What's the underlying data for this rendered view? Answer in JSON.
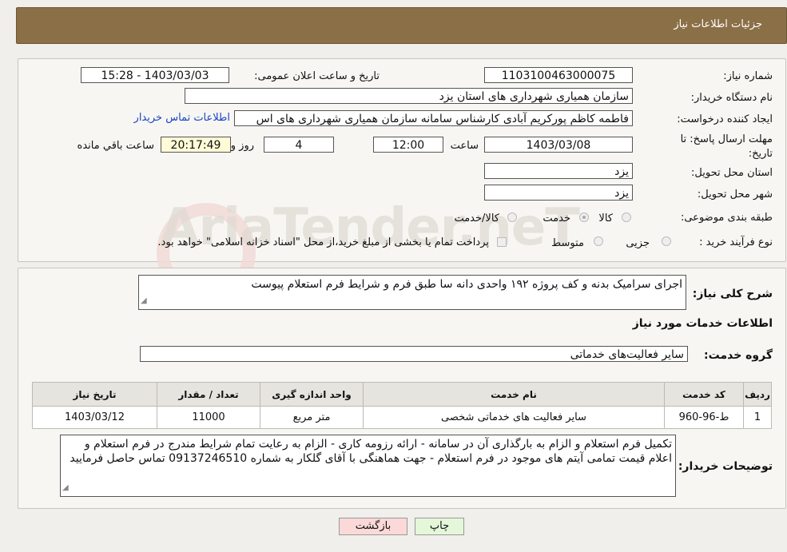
{
  "header": {
    "title": "جزئیات اطلاعات نیاز"
  },
  "info": {
    "need_number_label": "شماره نیاز:",
    "need_number": "1103100463000075",
    "announce_label": "تاریخ و ساعت اعلان عمومی:",
    "announce_value": "1403/03/03 - 15:28",
    "buyer_org_label": "نام دستگاه خریدار:",
    "buyer_org": "سازمان همیاری شهرداری های استان یزد",
    "requester_label": "ایجاد کننده درخواست:",
    "requester": "فاطمه کاظم پورکریم آبادی کارشناس سامانه سازمان همیاری شهرداری های اس",
    "contact_link": "اطلاعات تماس خریدار",
    "deadline_label": "مهلت ارسال پاسخ: تا تاریخ:",
    "deadline_date": "1403/03/08",
    "time_label": "ساعت",
    "deadline_time": "12:00",
    "days_value": "4",
    "days_label": "روز و",
    "remaining_time": "20:17:49",
    "remaining_label": "ساعت باقي مانده",
    "province_label": "استان محل تحویل:",
    "province": "یزد",
    "city_label": "شهر محل تحویل:",
    "city": "یزد",
    "category_label": "طبقه بندی موضوعی:",
    "category_options": [
      "کالا",
      "خدمت",
      "کالا/خدمت"
    ],
    "category_selected": "خدمت",
    "purchase_type_label": "نوع فرآیند خرید :",
    "purchase_options": [
      "جزیی",
      "متوسط"
    ],
    "payment_note": "پرداخت تمام یا بخشی از مبلغ خرید،از محل \"اسناد خزانه اسلامی\" خواهد بود."
  },
  "description": {
    "label": "شرح کلی نیاز:",
    "text": "اجرای سرامیک بدنه و کف پروژه ۱۹۲ واحدی دانه سا طبق فرم و شرایط فرم استعلام پیوست"
  },
  "services": {
    "section_title": "اطلاعات خدمات مورد نیاز",
    "group_label": "گروه خدمت:",
    "group_value": "سایر فعالیت‌های خدماتی",
    "columns": [
      "ردیف",
      "کد خدمت",
      "نام خدمت",
      "واحد اندازه گیری",
      "تعداد / مقدار",
      "تاریخ نیاز"
    ],
    "rows": [
      [
        "1",
        "ط-96-960",
        "سایر فعالیت های خدماتی شخصی",
        "متر مربع",
        "11000",
        "1403/03/12"
      ]
    ]
  },
  "buyer_notes": {
    "label": "توضیحات خریدار:",
    "text": "تکمیل فرم استعلام و الزام به بارگذاری آن در سامانه - ارائه رزومه کاری - الزام به رعایت تمام شرایط مندرج در فرم استعلام و اعلام قیمت تمامی آیتم های موجود در فرم استعلام - جهت هماهنگی با آقای گلکار به شماره 09137246510 تماس حاصل فرمایید"
  },
  "buttons": {
    "print": "چاپ",
    "back": "بازگشت"
  },
  "watermark": "AriaTender.neT",
  "colors": {
    "header_bg": "#8b6f47",
    "link": "#1a44c5",
    "back_btn": "#fbd9d9",
    "print_btn": "#e4f7d9"
  }
}
